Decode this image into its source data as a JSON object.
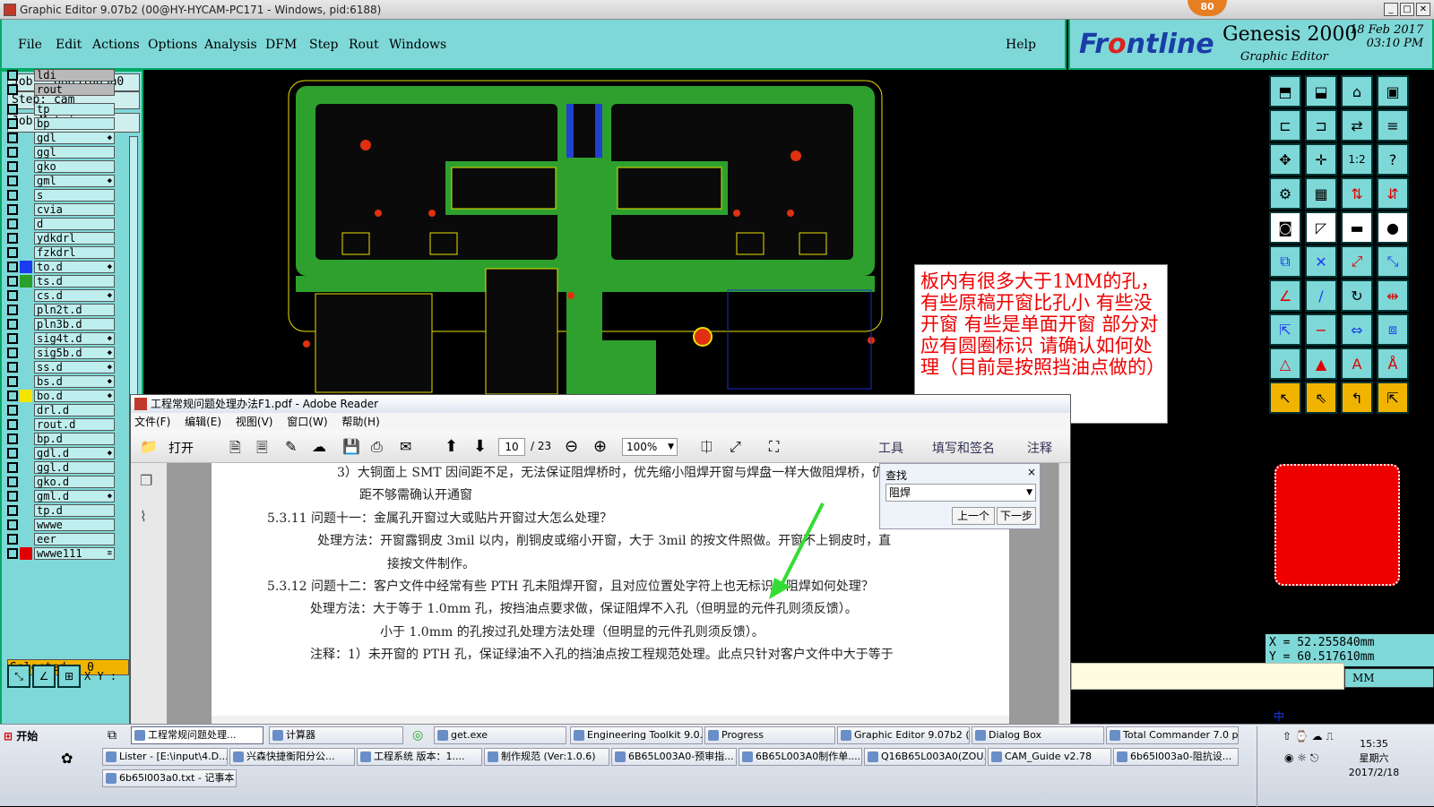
{
  "window": {
    "title": "Graphic Editor 9.07b2 (00@HY-HYCAM-PC171 - Windows, pid:6188)",
    "badge": "80"
  },
  "menu": {
    "items": [
      "File",
      "Edit",
      "Actions",
      "Options",
      "Analysis",
      "DFM",
      "Step",
      "Rout",
      "Windows"
    ],
    "help": "Help"
  },
  "brand": {
    "logo_prefix": "Fr",
    "logo_o": "o",
    "logo_suffix": "ntline",
    "product": "Genesis 2000",
    "sub": "Graphic Editor",
    "date": "18 Feb 2017",
    "time": "03:10 PM"
  },
  "job": {
    "job_label": "Job  :  6b651003a0",
    "step_label": "Step:  cam",
    "matrix_button": "Job Matrix ..."
  },
  "layers": [
    {
      "name": "ldi",
      "color": "",
      "mark": ""
    },
    {
      "name": "rout",
      "color": "",
      "mark": ""
    },
    {
      "name": "tp",
      "color": "",
      "mark": ""
    },
    {
      "name": "bp",
      "color": "",
      "mark": ""
    },
    {
      "name": "gdl",
      "color": "",
      "mark": "◆"
    },
    {
      "name": "ggl",
      "color": "",
      "mark": ""
    },
    {
      "name": "gko",
      "color": "",
      "mark": ""
    },
    {
      "name": "gml",
      "color": "",
      "mark": "◆"
    },
    {
      "name": "s",
      "color": "",
      "mark": ""
    },
    {
      "name": "cvia",
      "color": "",
      "mark": ""
    },
    {
      "name": "d",
      "color": "",
      "mark": ""
    },
    {
      "name": "ydkdrl",
      "color": "",
      "mark": ""
    },
    {
      "name": "fzkdrl",
      "color": "",
      "mark": ""
    },
    {
      "name": "to.d",
      "color": "#1a3df0",
      "mark": "◆"
    },
    {
      "name": "ts.d",
      "color": "#2aa02a",
      "mark": ""
    },
    {
      "name": "cs.d",
      "color": "",
      "mark": "◆"
    },
    {
      "name": "pln2t.d",
      "color": "",
      "mark": ""
    },
    {
      "name": "pln3b.d",
      "color": "",
      "mark": ""
    },
    {
      "name": "sig4t.d",
      "color": "",
      "mark": "◆"
    },
    {
      "name": "sig5b.d",
      "color": "",
      "mark": "◆"
    },
    {
      "name": "ss.d",
      "color": "",
      "mark": "◆"
    },
    {
      "name": "bs.d",
      "color": "",
      "mark": "◆"
    },
    {
      "name": "bo.d",
      "color": "#f5e400",
      "mark": "◆"
    },
    {
      "name": "drl.d",
      "color": "",
      "mark": ""
    },
    {
      "name": "rout.d",
      "color": "",
      "mark": ""
    },
    {
      "name": "bp.d",
      "color": "",
      "mark": ""
    },
    {
      "name": "gdl.d",
      "color": "",
      "mark": "◆"
    },
    {
      "name": "ggl.d",
      "color": "",
      "mark": ""
    },
    {
      "name": "gko.d",
      "color": "",
      "mark": ""
    },
    {
      "name": "gml.d",
      "color": "",
      "mark": "◆"
    },
    {
      "name": "tp.d",
      "color": "",
      "mark": ""
    },
    {
      "name": "wwwe",
      "color": "",
      "mark": ""
    },
    {
      "name": "eer",
      "color": "",
      "mark": ""
    },
    {
      "name": "wwwe111",
      "color": "#e00000",
      "mark": "≡"
    }
  ],
  "status": {
    "selected": "Selected : 0",
    "xy_label": "X Y :"
  },
  "coords": {
    "x": "X  =  52.255840mm",
    "y": "Y  =  60.517610mm",
    "units": "MM"
  },
  "note": {
    "text": "板内有很多大于1MM的孔，有些原稿开窗比孔小 有些没开窗  有些是单面开窗  部分对应有圆圈标识  请确认如何处理（目前是按照挡油点做的）"
  },
  "reader": {
    "title": "工程常规问题处理办法F1.pdf - Adobe Reader",
    "menu": [
      "文件(F)",
      "编辑(E)",
      "视图(V)",
      "窗口(W)",
      "帮助(H)"
    ],
    "open_button": "打开",
    "page_current": "10",
    "page_total": "/ 23",
    "zoom": "100%",
    "tools": "工具",
    "fill_sign": "填写和签名",
    "comment": "注释",
    "lines": [
      "3）大铜面上 SMT 因间距不足，无法保证阻焊桥时，优先缩小阻焊开窗与焊盘一样大做阻焊桥，仍间",
      "距不够需确认开通窗",
      "5.3.11 问题十一：金属孔开窗过大或贴片开窗过大怎么处理？",
      "处理方法：开窗露铜皮 3mil 以内，削铜皮或缩小开窗，大于 3mil 的按文件照做。开窗不上铜皮时，直",
      "接按文件制作。",
      "5.3.12 问题十二：客户文件中经常有些 PTH 孔未阻焊开窗，且对应位置处字符上也无标识，阻焊如何处理？",
      "处理方法：大于等于 1.0mm 孔，按挡油点要求做，保证阻焊不入孔（但明显的元件孔则须反馈）。",
      "小于 1.0mm 的孔按过孔处理方法处理（但明显的元件孔则须反馈）。",
      "注释：1）未开窗的 PTH 孔，保证绿油不入孔的挡油点按工程规范处理。此点只针对客户文件中大于等于"
    ],
    "find": {
      "title": "查找",
      "value": "阻焊",
      "prev": "上一个",
      "next": "下一步"
    }
  },
  "taskbar": {
    "start": "开始",
    "row1": [
      "工程常规问题处理...",
      "计算器",
      "get.exe",
      "Engineering Toolkit 9.0...",
      "Progress",
      "Graphic Editor 9.07b2 (...",
      "Dialog Box",
      "Total Commander 7.0 p..."
    ],
    "row2": [
      "Lister - [E:\\input\\4.D...",
      "兴森快捷衡阳分公...",
      "工程系统  版本：1....",
      "制作规范 (Ver:1.0.6)",
      "6B65L003A0-预审指...",
      "6B65L003A0制作单....",
      "Q16B65L003A0(ZOU...",
      "CAM_Guide v2.78",
      "6b65l003a0-阻抗设..."
    ],
    "row3": [
      "6b65l003a0.txt - 记事本"
    ],
    "tray_ime": "中",
    "clock_time": "15:35",
    "clock_day": "星期六",
    "clock_date": "2017/2/18"
  }
}
